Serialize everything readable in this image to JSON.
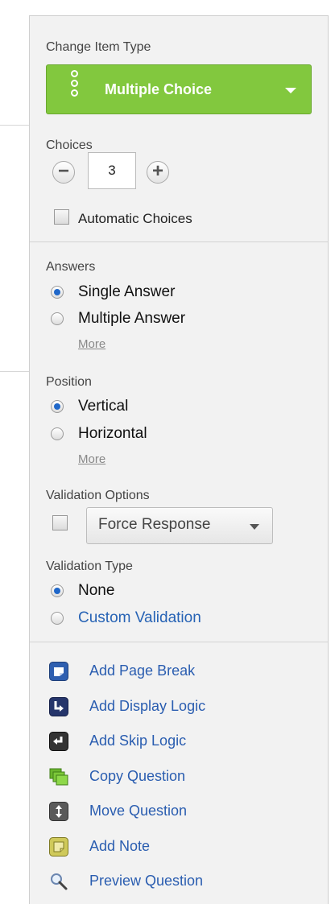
{
  "item_type": {
    "heading": "Change Item Type",
    "value": "Multiple Choice"
  },
  "choices": {
    "heading": "Choices",
    "count": "3",
    "auto_label": "Automatic Choices"
  },
  "answers": {
    "heading": "Answers",
    "options": [
      "Single Answer",
      "Multiple Answer"
    ],
    "selected": "Single Answer",
    "more": "More"
  },
  "position": {
    "heading": "Position",
    "options": [
      "Vertical",
      "Horizontal"
    ],
    "selected": "Vertical",
    "more": "More"
  },
  "validation_options": {
    "heading": "Validation Options",
    "select_value": "Force Response"
  },
  "validation_type": {
    "heading": "Validation Type",
    "options": [
      "None",
      "Custom Validation"
    ],
    "selected": "None"
  },
  "actions": [
    {
      "label": "Add Page Break",
      "icon": "page-break-icon"
    },
    {
      "label": "Add Display Logic",
      "icon": "display-logic-icon"
    },
    {
      "label": "Add Skip Logic",
      "icon": "skip-logic-icon"
    },
    {
      "label": "Copy Question",
      "icon": "copy-icon"
    },
    {
      "label": "Move Question",
      "icon": "move-icon"
    },
    {
      "label": "Add Note",
      "icon": "note-icon"
    },
    {
      "label": "Preview Question",
      "icon": "magnifier-icon"
    }
  ],
  "colors": {
    "accent_green": "#82c83e",
    "link_blue": "#2a5db0",
    "panel_bg": "#f2f2f2"
  }
}
